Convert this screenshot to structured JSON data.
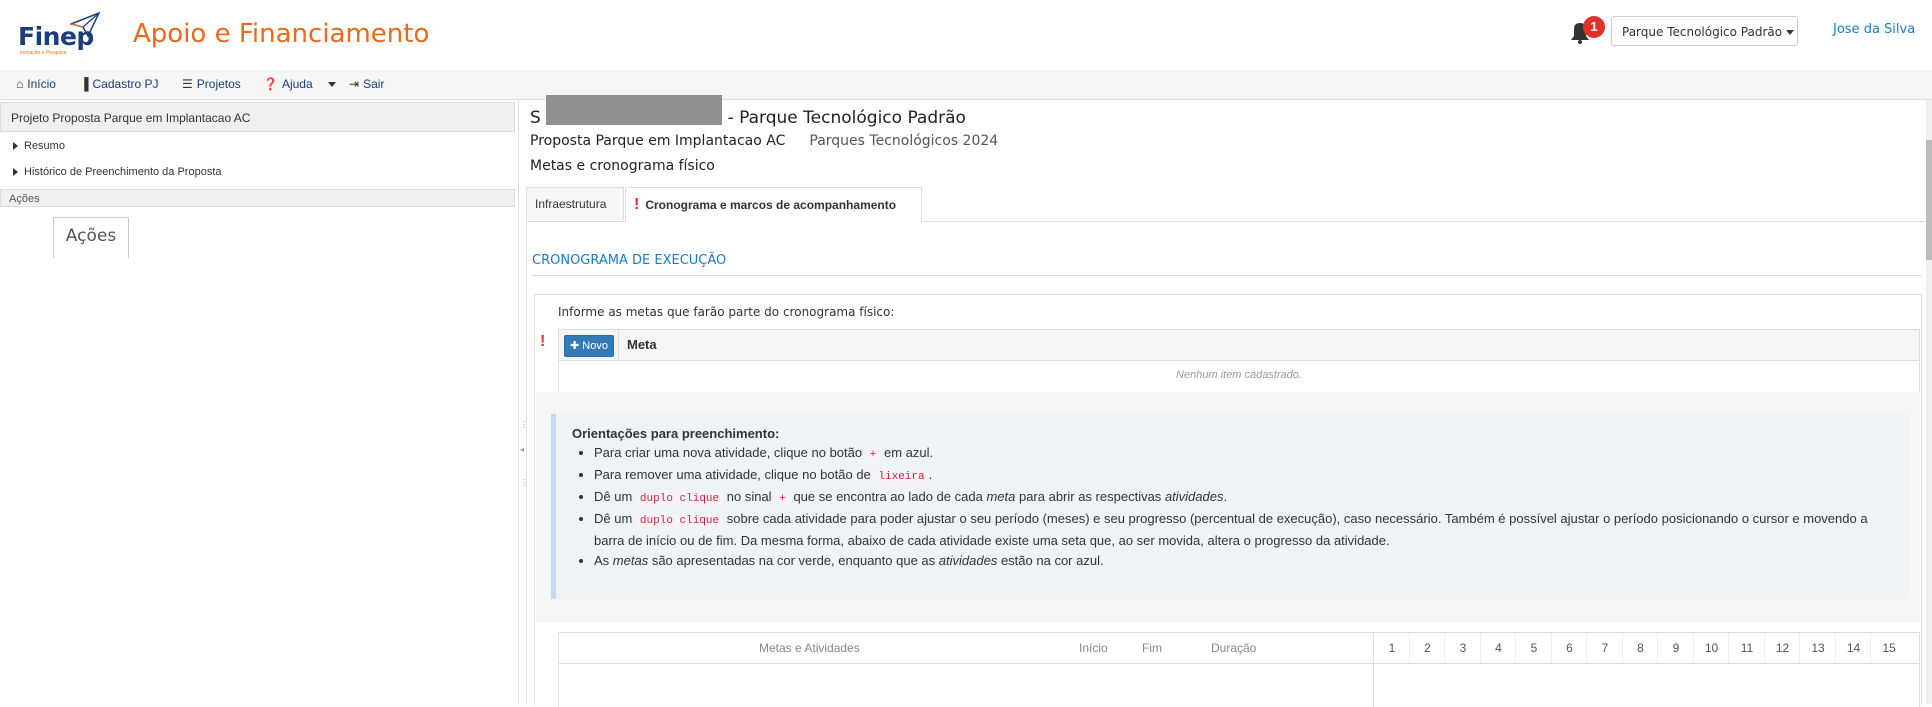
{
  "header": {
    "logo_text": "Finep",
    "logo_tagline": "Inovação e Pesquisa",
    "app_title": "Apoio e Financiamento",
    "notification_count": "1",
    "context_select": "Parque Tecnológico Padrão",
    "user_name": "Jose da Silva"
  },
  "navbar": {
    "items": [
      {
        "label": "Início",
        "icon": "home-icon"
      },
      {
        "label": "Cadastro PJ",
        "icon": "building-icon"
      },
      {
        "label": "Projetos",
        "icon": "list-icon"
      },
      {
        "label": "Ajuda",
        "icon": "question-circle-icon"
      },
      {
        "label": "Sair",
        "icon": "sign-out-icon"
      }
    ]
  },
  "sidebar": {
    "header": "Projeto Proposta Parque em Implantacao AC",
    "items": [
      {
        "label": "Resumo"
      },
      {
        "label": "Histórico de Preenchimento da Proposta"
      }
    ],
    "actions_header": "Ações",
    "actions_tab": "Ações"
  },
  "main": {
    "title": "- Parque Tecnológico Padrão",
    "title_prefix": "S",
    "proposal_name": "Proposta Parque em Implantacao AC",
    "program": "Parques Tecnológicos 2024",
    "section": "Metas e cronograma físico",
    "tabs": [
      {
        "label": "Infraestrutura",
        "active": false
      },
      {
        "label": "Cronograma e marcos de acompanhamento",
        "active": true,
        "warning": "!"
      }
    ],
    "crono_title": "CRONOGRAMA DE EXECUÇÃO",
    "metas_info": "Informe as metas que farão parte do cronograma físico:",
    "meta_warning": "!",
    "novo_button": "Novo",
    "meta_column": "Meta",
    "empty_text": "Nenhum item cadastrado.",
    "guide": {
      "title": "Orientações para preenchimento:",
      "lines": [
        {
          "before": "Para criar uma nova atividade, clique no botão",
          "code": "+",
          "after": "em azul."
        },
        {
          "before": "Para remover uma atividade, clique no botão de",
          "code": "lixeira",
          "after": "."
        },
        {
          "before": "Dê um",
          "code": "duplo clique",
          "middle": "no sinal",
          "code2": "+",
          "after": "que se encontra ao lado de cada",
          "em": "meta",
          "after2": "para abrir as respectivas",
          "em2": "atividades",
          "end": "."
        },
        {
          "before": "Dê um",
          "code": "duplo clique",
          "after": "sobre cada atividade para poder ajustar o seu período (meses) e seu progresso (percentual de execução), caso necessário. Também é possível ajustar o período posicionando o cursor e movendo a barra de início ou de fim. Da mesma forma, abaixo de cada atividade existe uma seta que, ao ser movida, altera o progresso da atividade."
        },
        {
          "before": "As",
          "em": "metas",
          "after": "são apresentadas na cor verde, enquanto que as",
          "em2": "atividades",
          "end": "estão na cor azul."
        }
      ]
    },
    "gantt": {
      "col_metas": "Metas e Atividades",
      "col_inicio": "Início",
      "col_fim": "Fim",
      "col_duracao": "Duração",
      "months": [
        "1",
        "2",
        "3",
        "4",
        "5",
        "6",
        "7",
        "8",
        "9",
        "10",
        "11",
        "12",
        "13",
        "14",
        "15"
      ]
    }
  },
  "colors": {
    "brand_orange": "#e86a1a",
    "brand_blue": "#1a3d7c",
    "link_blue": "#1a7bbf",
    "warning_red": "#e0312a",
    "button_blue": "#337ab7"
  }
}
